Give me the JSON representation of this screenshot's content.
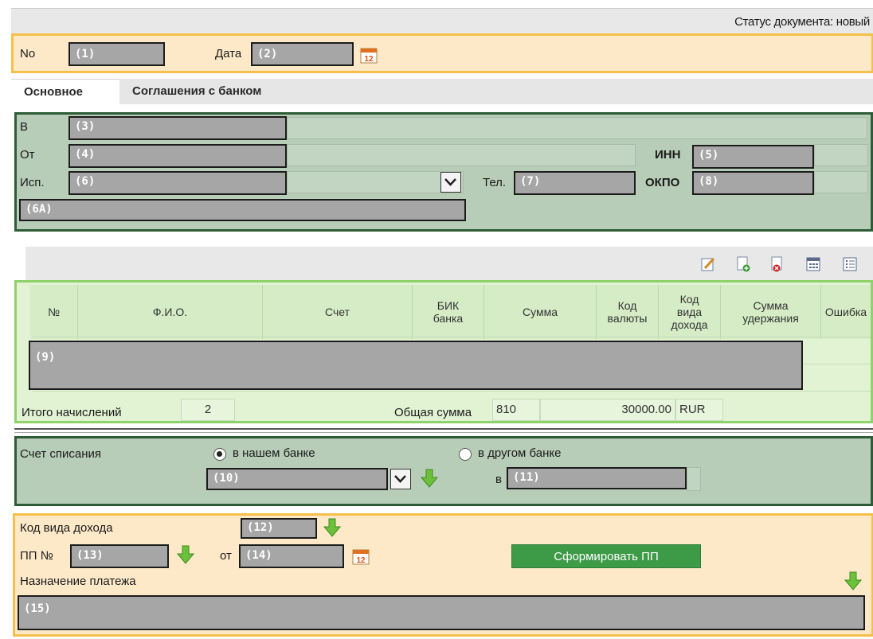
{
  "status": {
    "text": "Статус документа: новый"
  },
  "header": {
    "no_label": "No",
    "no_value": "(1)",
    "date_label": "Дата",
    "date_value": "(2)",
    "calendar_day": "12"
  },
  "tabs": [
    {
      "label": "Основное"
    },
    {
      "label": "Соглашения с банком"
    }
  ],
  "main": {
    "to_label": "В",
    "to_value": "(3)",
    "from_label": "От",
    "from_value": "(4)",
    "inn_label": "ИНН",
    "inn_value": "(5)",
    "executor_label": "Исп.",
    "executor_value": "(6)",
    "phone_label": "Тел.",
    "phone_value": "(7)",
    "okpo_label": "ОКПО",
    "okpo_value": "(8)",
    "extra_value": "(6A)"
  },
  "toolbar": {
    "icons": [
      "edit-icon",
      "add-document-icon",
      "delete-document-icon",
      "calculator-icon",
      "list-icon"
    ]
  },
  "table": {
    "columns": [
      "№",
      "Ф.И.О.",
      "Счет",
      "БИК\nбанка",
      "Сумма",
      "Код\nвалюты",
      "Код\nвида\nдохода",
      "Сумма\nудержания",
      "Ошибка"
    ],
    "rows_value": "(9)",
    "total_label": "Итого начислений",
    "total_value": "2",
    "sum_label": "Общая сумма",
    "sum_code": "810",
    "sum_value": "30000.00",
    "sum_currency": "RUR"
  },
  "debit": {
    "label": "Счет списания",
    "option_our": "в нашем банке",
    "option_other": "в другом банке",
    "selected": "в нашем банке",
    "account_value": "(10)",
    "in_label": "в",
    "other_value": "(11)"
  },
  "bottom": {
    "income_label": "Код вида дохода",
    "income_value": "(12)",
    "pp_label": "ПП №",
    "pp_value": "(13)",
    "from_label": "от",
    "from_value": "(14)",
    "calendar_day": "12",
    "generate_label": "Сформировать ПП",
    "purpose_label": "Назначение платежа",
    "purpose_value": "(15)"
  },
  "colors": {
    "orange_bg": "#fde9c8",
    "orange_border": "#f6bf49",
    "green_bg": "#b8cdb8",
    "green_border": "#2e5c37",
    "table_bg": "#e1f3d3",
    "table_border": "#8ed26a",
    "button": "#3d9a47"
  }
}
